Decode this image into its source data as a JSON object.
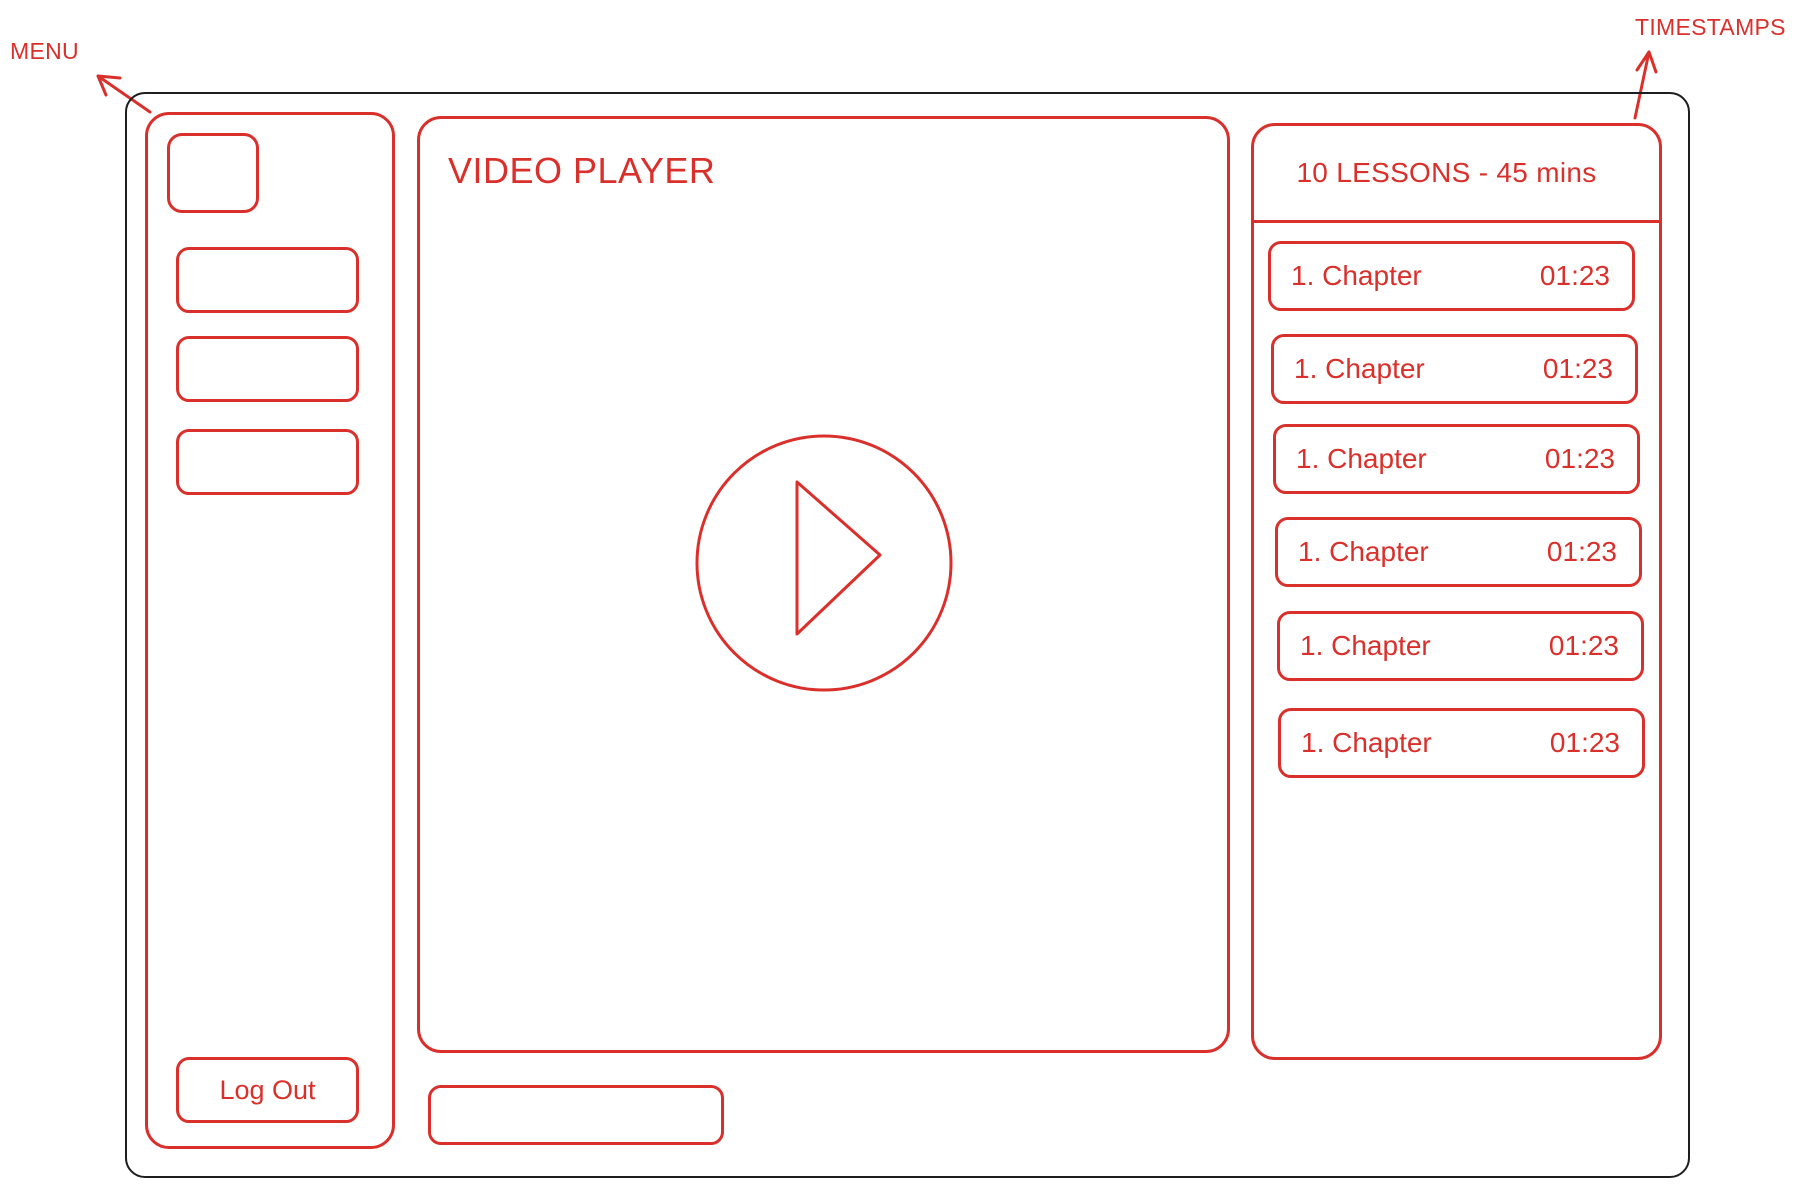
{
  "annotations": {
    "menu_label": "MENU",
    "timestamps_label": "TIMESTAMPS"
  },
  "menu": {
    "logout_label": "Log Out"
  },
  "player": {
    "title": "VIDEO PLAYER"
  },
  "timestamps": {
    "header": "10 LESSONS - 45 mins",
    "chapters": [
      {
        "title": "1. Chapter",
        "time": "01:23"
      },
      {
        "title": "1. Chapter",
        "time": "01:23"
      },
      {
        "title": "1. Chapter",
        "time": "01:23"
      },
      {
        "title": "1. Chapter",
        "time": "01:23"
      },
      {
        "title": "1. Chapter",
        "time": "01:23"
      },
      {
        "title": "1. Chapter",
        "time": "01:23"
      }
    ]
  },
  "colors": {
    "accent": "#d9302c",
    "frame": "#1e1e1e"
  },
  "icons": {
    "play": "play-icon",
    "arrow": "arrow-icon"
  }
}
